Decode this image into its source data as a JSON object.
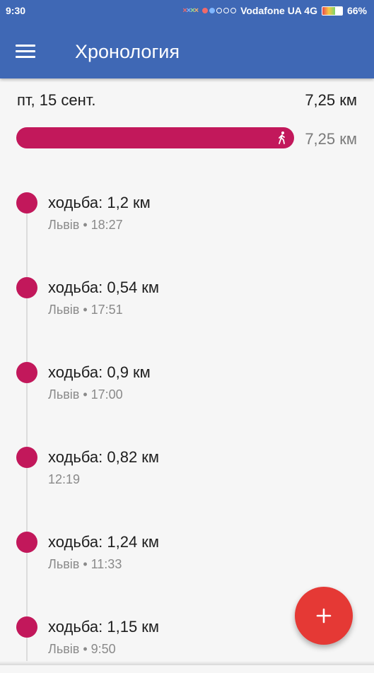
{
  "status_bar": {
    "time": "9:30",
    "carrier": "Vodafone UA 4G",
    "battery": "66%",
    "battery_level": 0.66
  },
  "app_bar": {
    "title": "Хронология",
    "menu_icon": "hamburger-menu-icon"
  },
  "summary": {
    "date": "пт, 15 сент.",
    "total": "7,25 км",
    "bar_label": "7,25 км",
    "bar_icon": "walking-icon"
  },
  "timeline": [
    {
      "title": "ходьба: 1,2 км",
      "subtitle": "Львів • 18:27"
    },
    {
      "title": "ходьба: 0,54 км",
      "subtitle": "Львів • 17:51"
    },
    {
      "title": "ходьба: 0,9 км",
      "subtitle": "Львів • 17:00"
    },
    {
      "title": "ходьба: 0,82 км",
      "subtitle": "12:19"
    },
    {
      "title": "ходьба: 1,24 км",
      "subtitle": "Львів • 11:33"
    },
    {
      "title": "ходьба: 1,15 км",
      "subtitle": "Львів • 9:50"
    }
  ],
  "fab": {
    "icon": "plus-icon"
  },
  "colors": {
    "app_bar": "#3f68b5",
    "accent": "#c2185b",
    "fab": "#e53935"
  }
}
